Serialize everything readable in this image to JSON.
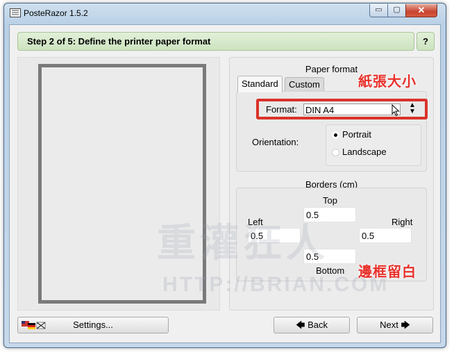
{
  "window": {
    "title": "PosteRazor 1.5.2",
    "controls": {
      "minimize": "▭",
      "maximize": "▢",
      "close": "✕"
    }
  },
  "step": {
    "title": "Step 2 of 5: Define the printer paper format",
    "help": "?"
  },
  "paper_format": {
    "heading": "Paper format",
    "tabs": [
      "Standard",
      "Custom"
    ],
    "selected_tab": "Standard",
    "format_label": "Format:",
    "format_value": "DIN A4",
    "orientation_label": "Orientation:",
    "orientations": [
      "Portrait",
      "Landscape"
    ],
    "selected_orientation": "Portrait"
  },
  "borders": {
    "heading": "Borders (cm)",
    "top_label": "Top",
    "top_value": "0.5",
    "left_label": "Left",
    "left_value": "0.5",
    "right_label": "Right",
    "right_value": "0.5",
    "bottom_label": "Bottom",
    "bottom_value": "0.5"
  },
  "annotations": {
    "paper_size": "紙張大小",
    "margins": "邊框留白"
  },
  "watermark": {
    "line1": "重灌狂人",
    "line2": "HTTP://BRIAN.COM"
  },
  "buttons": {
    "settings": "Settings...",
    "back": "Back",
    "next": "Next"
  },
  "icons": {
    "back_arrow": "🡄",
    "next_arrow": "🡆"
  },
  "colors": {
    "accent_red": "#d9332a",
    "step_bar": "#cce3bf",
    "title_bar": "#b9d0e6"
  }
}
